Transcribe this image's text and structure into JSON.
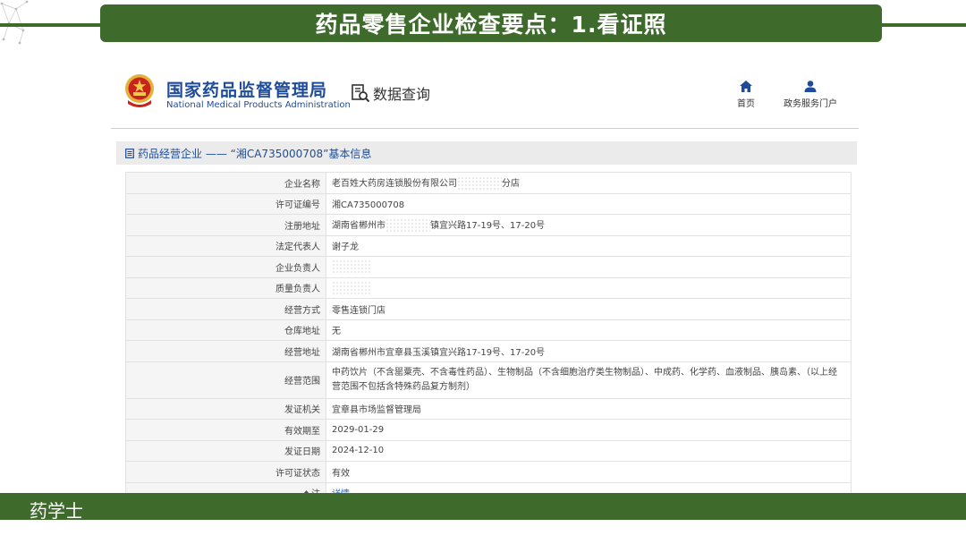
{
  "slide": {
    "title": "药品零售企业检查要点：1.看证照",
    "brand": "药学士"
  },
  "site": {
    "agency_name_zh": "国家药品监督管理局",
    "agency_name_en": "National Medical Products Administration",
    "data_query": "数据查询",
    "nav": [
      {
        "label": "首页",
        "icon": "home-icon"
      },
      {
        "label": "政务服务门户",
        "icon": "user-icon"
      }
    ]
  },
  "section": {
    "title": "药品经营企业 —— “湘CA735000708”基本信息",
    "icon": "document-icon"
  },
  "table": {
    "rows": [
      {
        "key": "企业名称",
        "value_before": "老百姓大药房连锁股份有限公司",
        "value_after": "分店",
        "redacted": true
      },
      {
        "key": "许可证编号",
        "value": "湘CA735000708"
      },
      {
        "key": "注册地址",
        "value_before": "湖南省郴州市",
        "value_after": "镇宜兴路17-19号、17-20号",
        "redacted": true
      },
      {
        "key": "法定代表人",
        "value": "谢子龙"
      },
      {
        "key": "企业负责人",
        "value": "",
        "redacted": true
      },
      {
        "key": "质量负责人",
        "value": "",
        "redacted": true
      },
      {
        "key": "经营方式",
        "value": "零售连锁门店"
      },
      {
        "key": "仓库地址",
        "value": "无"
      },
      {
        "key": "经营地址",
        "value": "湖南省郴州市宜章县玉溪镇宜兴路17-19号、17-20号"
      },
      {
        "key": "经营范围",
        "value": "中药饮片（不含罂粟壳、不含毒性药品）、生物制品（不含细胞治疗类生物制品）、中成药、化学药、血液制品、胰岛素、（以上经营范围不包括含特殊药品复方制剂）"
      },
      {
        "key": "发证机关",
        "value": "宜章县市场监督管理局"
      },
      {
        "key": "有效期至",
        "value": "2029-01-29"
      },
      {
        "key": "发证日期",
        "value": "2024-12-10"
      },
      {
        "key": "许可证状态",
        "value": "有效"
      },
      {
        "key": "注",
        "value": "详情"
      }
    ]
  },
  "colors": {
    "slide_green": "#3e6a2c",
    "agency_blue": "#1e4c9a",
    "link_blue": "#2a6fc1"
  }
}
